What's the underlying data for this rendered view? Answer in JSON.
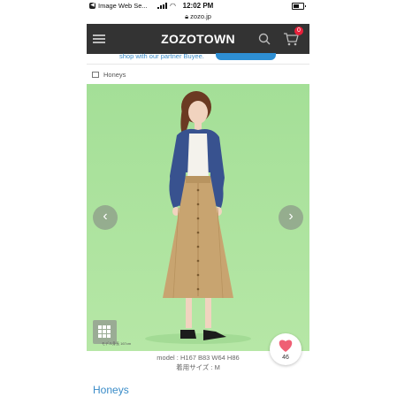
{
  "status_bar": {
    "back_app": "Image Web Se...",
    "time": "12:02 PM",
    "url": "zozo.jp"
  },
  "header": {
    "logo": "ZOZOTOWN",
    "cart_count": "0"
  },
  "banner": {
    "text": "shop with our partner Buyee."
  },
  "crumb": {
    "brand": "Honeys"
  },
  "product": {
    "photo_caption": "モデル身長 167cm",
    "model_info": "model : H167 B83 W64 H86",
    "size_info": "着用サイズ : M",
    "like_count": "46",
    "brand_title": "Honeys"
  },
  "icons": {
    "back": "back-app-icon",
    "signal": "signal-icon",
    "wifi": "wifi-icon",
    "battery": "battery-icon",
    "lock": "lock-icon",
    "menu": "hamburger-icon",
    "search": "search-icon",
    "cart": "cart-icon",
    "shop": "shop-icon",
    "prev": "chevron-left-icon",
    "next": "chevron-right-icon",
    "grid": "grid-icon",
    "heart": "heart-icon"
  },
  "colors": {
    "header_bg": "#333333",
    "photo_bg": "#a9e29a",
    "accent_blue": "#3a8cc8",
    "badge_red": "#e8203a",
    "heart_pink": "#ef5f74"
  }
}
